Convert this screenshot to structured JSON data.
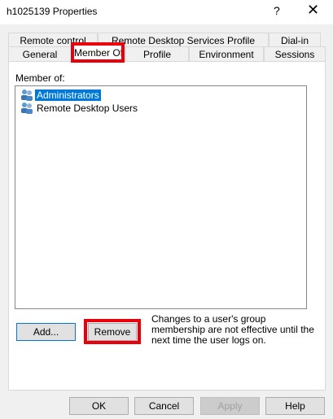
{
  "window": {
    "title": "h1025139 Properties",
    "help_glyph": "?",
    "close_glyph": "✕"
  },
  "tabs": {
    "row1": [
      "Remote control",
      "Remote Desktop Services Profile",
      "Dial-in"
    ],
    "row2": [
      "General",
      "Member Of",
      "Profile",
      "Environment",
      "Sessions"
    ],
    "active": "Member Of"
  },
  "member_of": {
    "label": "Member of:",
    "items": [
      {
        "name": "Administrators",
        "selected": true,
        "icon": "group-icon"
      },
      {
        "name": "Remote Desktop Users",
        "selected": false,
        "icon": "group-icon"
      }
    ]
  },
  "buttons": {
    "add": "Add...",
    "remove": "Remove",
    "ok": "OK",
    "cancel": "Cancel",
    "apply": "Apply",
    "help": "Help"
  },
  "note": "Changes to a user's group membership are not effective until the next time the user logs on.",
  "colors": {
    "highlight": "#e8000d",
    "selection": "#0078d7"
  }
}
